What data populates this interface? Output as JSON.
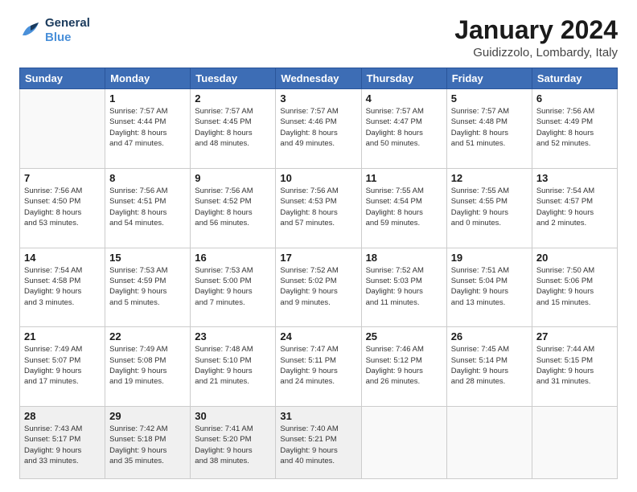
{
  "logo": {
    "line1": "General",
    "line2": "Blue"
  },
  "title": "January 2024",
  "subtitle": "Guidizzolo, Lombardy, Italy",
  "weekdays": [
    "Sunday",
    "Monday",
    "Tuesday",
    "Wednesday",
    "Thursday",
    "Friday",
    "Saturday"
  ],
  "weeks": [
    [
      {
        "day": null,
        "info": null
      },
      {
        "day": "1",
        "info": "Sunrise: 7:57 AM\nSunset: 4:44 PM\nDaylight: 8 hours\nand 47 minutes."
      },
      {
        "day": "2",
        "info": "Sunrise: 7:57 AM\nSunset: 4:45 PM\nDaylight: 8 hours\nand 48 minutes."
      },
      {
        "day": "3",
        "info": "Sunrise: 7:57 AM\nSunset: 4:46 PM\nDaylight: 8 hours\nand 49 minutes."
      },
      {
        "day": "4",
        "info": "Sunrise: 7:57 AM\nSunset: 4:47 PM\nDaylight: 8 hours\nand 50 minutes."
      },
      {
        "day": "5",
        "info": "Sunrise: 7:57 AM\nSunset: 4:48 PM\nDaylight: 8 hours\nand 51 minutes."
      },
      {
        "day": "6",
        "info": "Sunrise: 7:56 AM\nSunset: 4:49 PM\nDaylight: 8 hours\nand 52 minutes."
      }
    ],
    [
      {
        "day": "7",
        "info": "Sunrise: 7:56 AM\nSunset: 4:50 PM\nDaylight: 8 hours\nand 53 minutes."
      },
      {
        "day": "8",
        "info": "Sunrise: 7:56 AM\nSunset: 4:51 PM\nDaylight: 8 hours\nand 54 minutes."
      },
      {
        "day": "9",
        "info": "Sunrise: 7:56 AM\nSunset: 4:52 PM\nDaylight: 8 hours\nand 56 minutes."
      },
      {
        "day": "10",
        "info": "Sunrise: 7:56 AM\nSunset: 4:53 PM\nDaylight: 8 hours\nand 57 minutes."
      },
      {
        "day": "11",
        "info": "Sunrise: 7:55 AM\nSunset: 4:54 PM\nDaylight: 8 hours\nand 59 minutes."
      },
      {
        "day": "12",
        "info": "Sunrise: 7:55 AM\nSunset: 4:55 PM\nDaylight: 9 hours\nand 0 minutes."
      },
      {
        "day": "13",
        "info": "Sunrise: 7:54 AM\nSunset: 4:57 PM\nDaylight: 9 hours\nand 2 minutes."
      }
    ],
    [
      {
        "day": "14",
        "info": "Sunrise: 7:54 AM\nSunset: 4:58 PM\nDaylight: 9 hours\nand 3 minutes."
      },
      {
        "day": "15",
        "info": "Sunrise: 7:53 AM\nSunset: 4:59 PM\nDaylight: 9 hours\nand 5 minutes."
      },
      {
        "day": "16",
        "info": "Sunrise: 7:53 AM\nSunset: 5:00 PM\nDaylight: 9 hours\nand 7 minutes."
      },
      {
        "day": "17",
        "info": "Sunrise: 7:52 AM\nSunset: 5:02 PM\nDaylight: 9 hours\nand 9 minutes."
      },
      {
        "day": "18",
        "info": "Sunrise: 7:52 AM\nSunset: 5:03 PM\nDaylight: 9 hours\nand 11 minutes."
      },
      {
        "day": "19",
        "info": "Sunrise: 7:51 AM\nSunset: 5:04 PM\nDaylight: 9 hours\nand 13 minutes."
      },
      {
        "day": "20",
        "info": "Sunrise: 7:50 AM\nSunset: 5:06 PM\nDaylight: 9 hours\nand 15 minutes."
      }
    ],
    [
      {
        "day": "21",
        "info": "Sunrise: 7:49 AM\nSunset: 5:07 PM\nDaylight: 9 hours\nand 17 minutes."
      },
      {
        "day": "22",
        "info": "Sunrise: 7:49 AM\nSunset: 5:08 PM\nDaylight: 9 hours\nand 19 minutes."
      },
      {
        "day": "23",
        "info": "Sunrise: 7:48 AM\nSunset: 5:10 PM\nDaylight: 9 hours\nand 21 minutes."
      },
      {
        "day": "24",
        "info": "Sunrise: 7:47 AM\nSunset: 5:11 PM\nDaylight: 9 hours\nand 24 minutes."
      },
      {
        "day": "25",
        "info": "Sunrise: 7:46 AM\nSunset: 5:12 PM\nDaylight: 9 hours\nand 26 minutes."
      },
      {
        "day": "26",
        "info": "Sunrise: 7:45 AM\nSunset: 5:14 PM\nDaylight: 9 hours\nand 28 minutes."
      },
      {
        "day": "27",
        "info": "Sunrise: 7:44 AM\nSunset: 5:15 PM\nDaylight: 9 hours\nand 31 minutes."
      }
    ],
    [
      {
        "day": "28",
        "info": "Sunrise: 7:43 AM\nSunset: 5:17 PM\nDaylight: 9 hours\nand 33 minutes."
      },
      {
        "day": "29",
        "info": "Sunrise: 7:42 AM\nSunset: 5:18 PM\nDaylight: 9 hours\nand 35 minutes."
      },
      {
        "day": "30",
        "info": "Sunrise: 7:41 AM\nSunset: 5:20 PM\nDaylight: 9 hours\nand 38 minutes."
      },
      {
        "day": "31",
        "info": "Sunrise: 7:40 AM\nSunset: 5:21 PM\nDaylight: 9 hours\nand 40 minutes."
      },
      {
        "day": null,
        "info": null
      },
      {
        "day": null,
        "info": null
      },
      {
        "day": null,
        "info": null
      }
    ]
  ]
}
